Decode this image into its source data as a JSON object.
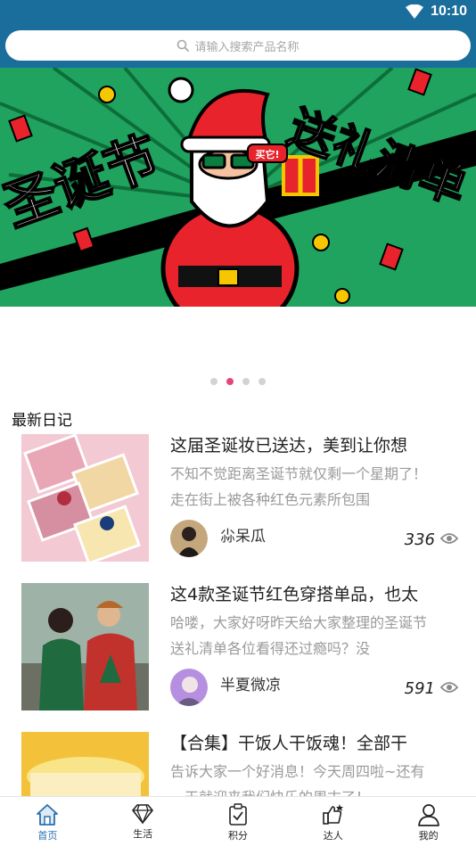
{
  "status": {
    "time": "10:10"
  },
  "search": {
    "placeholder": "请输入搜索产品名称"
  },
  "banner": {
    "text_left": "圣诞节",
    "text_right": "送礼清单",
    "bubble": "买它!"
  },
  "carousel": {
    "count": 4,
    "active_index": 1
  },
  "section_title": "最新日记",
  "articles": [
    {
      "title": "这届圣诞妆已送达，美到让你想",
      "desc": "不知不觉距离圣诞节就仅剩一个星期了！走在街上被各种红色元素所包围",
      "author": "尛呆瓜",
      "views": "336"
    },
    {
      "title": "这4款圣诞节红色穿搭单品，也太",
      "desc": "哈喽，大家好呀昨天给大家整理的圣诞节送礼清单各位看得还过瘾吗？没",
      "author": "半夏微凉",
      "views": "591"
    },
    {
      "title": "【合集】干饭人干饭魂！全部干",
      "desc": "告诉大家一个好消息！今天周四啦~还有一天就迎来我们快乐的周末了！",
      "author": "",
      "views": ""
    }
  ],
  "tabs": [
    {
      "label": "首页",
      "icon": "home-icon",
      "active": true
    },
    {
      "label": "生活",
      "icon": "diamond-icon",
      "active": false
    },
    {
      "label": "积分",
      "icon": "clipboard-check-icon",
      "active": false
    },
    {
      "label": "达人",
      "icon": "thumbs-up-icon",
      "active": false
    },
    {
      "label": "我的",
      "icon": "person-icon",
      "active": false
    }
  ],
  "colors": {
    "header": "#1a6e9c",
    "accent_dot": "#e5467a",
    "active_tab": "#2a6fb0"
  }
}
